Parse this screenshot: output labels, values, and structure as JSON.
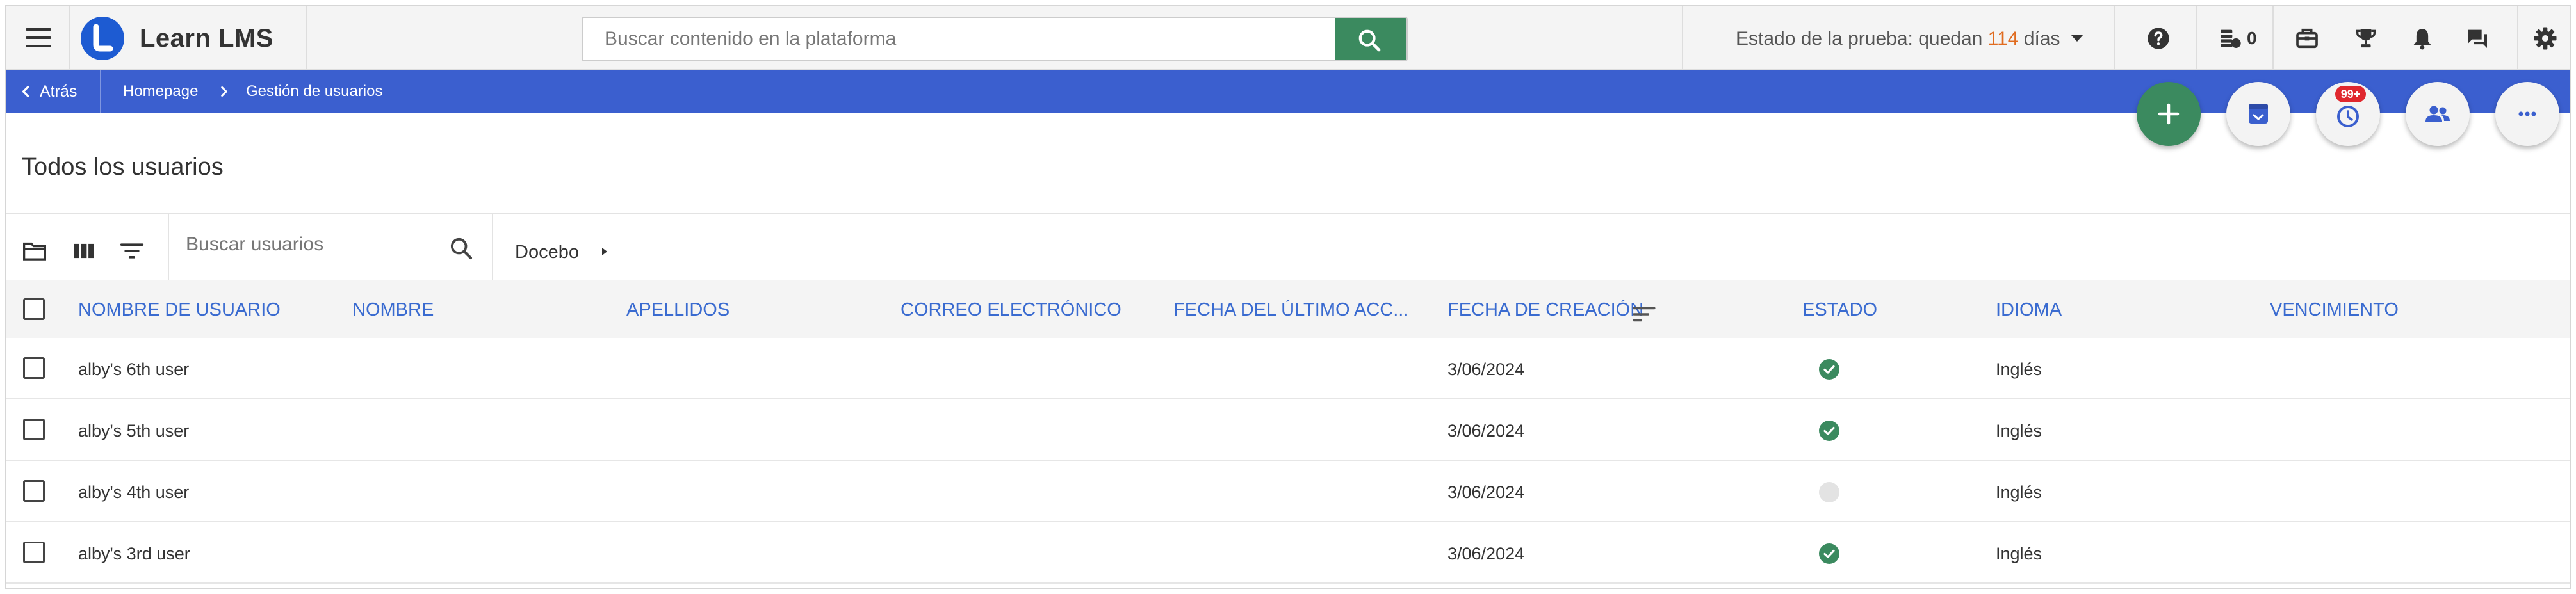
{
  "app": {
    "brand": "Learn LMS",
    "search_placeholder": "Buscar contenido en la plataforma",
    "trial_prefix": "Estado de la prueba: quedan",
    "trial_days": "114",
    "trial_suffix": "días",
    "coins_count": "0",
    "colors": {
      "accent": "#3b5fcf",
      "brand": "#1d5bd2",
      "success": "#3b8a5f",
      "trial_days": "#e06b1f",
      "badge": "#e0282e",
      "header_text": "#3a6bd0"
    }
  },
  "topbar_icons": [
    "help-icon",
    "coins-icon",
    "catalog-icon",
    "trophy-icon",
    "bell-icon",
    "chat-icon",
    "settings-icon"
  ],
  "breadcrumb": {
    "back_label": "Atrás",
    "items": [
      "Homepage",
      "Gestión de usuarios"
    ]
  },
  "fabs": {
    "notification_badge": "99+",
    "icons": [
      "add-icon",
      "archive-icon",
      "history-icon",
      "users-icon",
      "more-icon"
    ]
  },
  "page": {
    "title": "Todos los usuarios"
  },
  "toolbar": {
    "search_placeholder": "Buscar usuarios",
    "branch": "Docebo",
    "icons": [
      "folder-icon",
      "columns-icon",
      "filter-icon",
      "search-icon",
      "chevron-right-icon"
    ]
  },
  "table": {
    "columns": [
      "NOMBRE DE USUARIO",
      "NOMBRE",
      "APELLIDOS",
      "CORREO ELECTRÓNICO",
      "FECHA DEL ÚLTIMO ACC...",
      "FECHA DE CREACIÓN",
      "ESTADO",
      "IDIOMA",
      "VENCIMIENTO"
    ],
    "rows": [
      {
        "username": "alby's 6th user",
        "first_name": "",
        "last_name": "",
        "email": "",
        "last_access": "",
        "created": "3/06/2024",
        "status": "active",
        "language": "Inglés",
        "expiration": ""
      },
      {
        "username": "alby's 5th user",
        "first_name": "",
        "last_name": "",
        "email": "",
        "last_access": "",
        "created": "3/06/2024",
        "status": "active",
        "language": "Inglés",
        "expiration": ""
      },
      {
        "username": "alby's 4th user",
        "first_name": "",
        "last_name": "",
        "email": "",
        "last_access": "",
        "created": "3/06/2024",
        "status": "inactive",
        "language": "Inglés",
        "expiration": ""
      },
      {
        "username": "alby's 3rd user",
        "first_name": "",
        "last_name": "",
        "email": "",
        "last_access": "",
        "created": "3/06/2024",
        "status": "active",
        "language": "Inglés",
        "expiration": ""
      }
    ]
  }
}
